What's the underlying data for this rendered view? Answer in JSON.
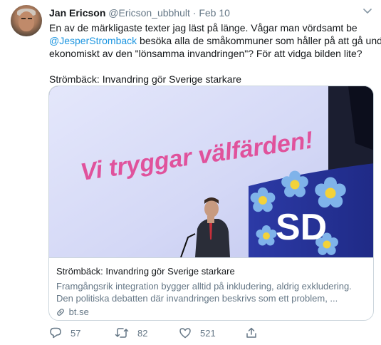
{
  "author": {
    "name": "Jan Ericson",
    "handle": "@Ericson_ubbhult",
    "separator": "·",
    "date": "Feb 10"
  },
  "tweet": {
    "line1": "En av de märkligaste texter jag läst på länge. Vågar man vördsamt be",
    "mention": "@JesperStromback",
    "line2_rest": " besöka alla de småkommuner som håller på att gå under",
    "line3": "ekonomiskt av den \"lönsamma invandringen\"? För att vidga bilden lite?",
    "line4": "Strömbäck: Invandring gör Sverige starkare"
  },
  "card": {
    "image_banner_text": "Vi tryggar välfärden!",
    "image_logo_text": "SD",
    "title": "Strömbäck: Invandring gör Sverige starkare",
    "description_line1": "Framgångsrik integration bygger alltid på inkludering, aldrig exkludering.",
    "description_line2": "Den politiska debatten där invandringen beskrivs som ett problem, ...",
    "domain": "bt.se"
  },
  "actions": {
    "replies": "57",
    "retweets": "82",
    "likes": "521"
  },
  "colors": {
    "link": "#1b95e0",
    "muted": "#657786",
    "border": "#ccd6dd",
    "banner_text": "#e0529c",
    "screen_blue": "#2a3a9e"
  },
  "icons": [
    "chevron-down-icon",
    "link-icon",
    "reply-icon",
    "retweet-icon",
    "like-icon",
    "share-icon"
  ]
}
